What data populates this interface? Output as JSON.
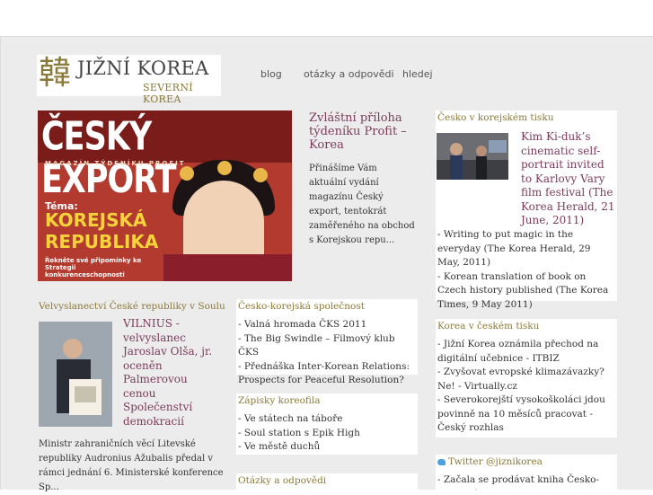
{
  "logo": {
    "glyph": "韓",
    "title": "JIŽNÍ KOREA",
    "subtitle": "SEVERNÍ KOREA"
  },
  "nav": {
    "blog": "blog",
    "qa": "otázky a odpovědi",
    "search": "hledej"
  },
  "hero": {
    "masthead": "ČESKÝ EXPORT",
    "masthead_sub": "MAGAZÍN TÝDENÍKU PROFIT",
    "tema": "Téma:",
    "line1": "KOREJSKÁ",
    "line2": "REPUBLIKA",
    "small": "Řekněte své připomínky ke Strategii konkurenceschopnosti"
  },
  "feature": {
    "title": "Zvláštní příloha týdeníku Profit –Korea",
    "text": "Přinášíme Vám aktuální vydání magazínu Český export, tentokrát zaměřeného na obchod s Korejskou repu..."
  },
  "cesko_v_tisku": {
    "heading": "Česko v korejském tisku",
    "lead": "Kim Ki-duk’s cinematic self-portrait invited to Karlovy Vary film festival (The Korea Herald, 21 June, 2011)",
    "items": [
      "- Writing to put magic in the everyday (The Korea Herald, 29 May, 2011)",
      "- Korean translation of book on Czech history published (The Korea Times, 9 May 2011)"
    ]
  },
  "velvyslanectvi": {
    "heading": "Velvyslanectví České republiky v Soulu",
    "lead": "VILNIUS - velvyslanec Jaroslav Olša, jr. oceněn Palmerovou cenou Společenství demokracií",
    "text": "Ministr zahraničních věcí Litevské republiky Audronius Ažubalis předal v rámci jednání 6. Ministerské konference Sp..."
  },
  "spolecnost": {
    "heading": "Česko-korejská společnost",
    "items": [
      "- Valná hromada ČKS 2011",
      "- The Big Swindle – Filmový klub ČKS",
      "- Přednáška Inter-Korean Relations: Prospects for Peaceful Resolution?"
    ]
  },
  "zapisky": {
    "heading": "Zápisky koreofila",
    "items": [
      "- Ve státech na táboře",
      "- Soul station s Epik High",
      "- Ve městě duchů"
    ]
  },
  "otazky": {
    "heading": "Otázky a odpovědi"
  },
  "korea_v_tisku": {
    "heading": "Korea v českém tisku",
    "items": [
      "- Jižní Korea oznámila přechod na digitální učebnice - ITBIZ",
      "- Zvyšovat evropské klimazávazky? Ne! - Virtually.cz",
      "- Severokorejští vysokoškoláci jdou povinně na 10 měsíců pracovat - Český rozhlas"
    ]
  },
  "twitter": {
    "heading": "Twitter @jiznikorea",
    "items": [
      "- Začala se prodávat kniha Česko-korejská"
    ]
  },
  "icons": {
    "twitter": "twitter-bird-icon"
  },
  "colors": {
    "accent": "#7b3c5c",
    "heading": "#8a7a3a",
    "background": "#ececec"
  }
}
